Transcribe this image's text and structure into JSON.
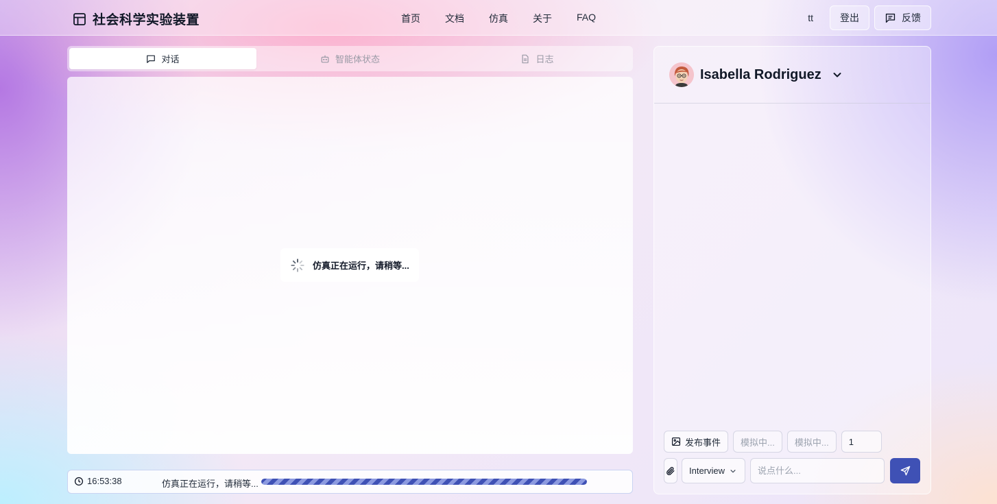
{
  "brand": {
    "title": "社会科学实验装置",
    "icon": "layout-icon"
  },
  "nav": {
    "links": [
      "首页",
      "文档",
      "仿真",
      "关于",
      "FAQ"
    ]
  },
  "header_right": {
    "user": "tt",
    "logout_label": "登出",
    "feedback_label": "反馈",
    "feedback_icon": "message-square-icon"
  },
  "tabs": [
    {
      "label": "对话",
      "icon": "message-square-icon",
      "active": true
    },
    {
      "label": "智能体状态",
      "icon": "bot-icon",
      "active": false
    },
    {
      "label": "日志",
      "icon": "file-text-icon",
      "active": false
    }
  ],
  "chat": {
    "loading_text": "仿真正在运行，请稍等..."
  },
  "status": {
    "time": "16:53:38",
    "message": "仿真正在运行，请稍等...",
    "progress": 1.0
  },
  "agent": {
    "name": "Isabella Rodriguez"
  },
  "controls": {
    "publish_label": "发布事件",
    "sim_a": "模拟中...",
    "sim_b": "模拟中...",
    "count": "1",
    "mode": "Interview",
    "input_placeholder": "说点什么..."
  },
  "colors": {
    "accent": "#3f51b5",
    "accent_light": "#8c9ae0"
  }
}
